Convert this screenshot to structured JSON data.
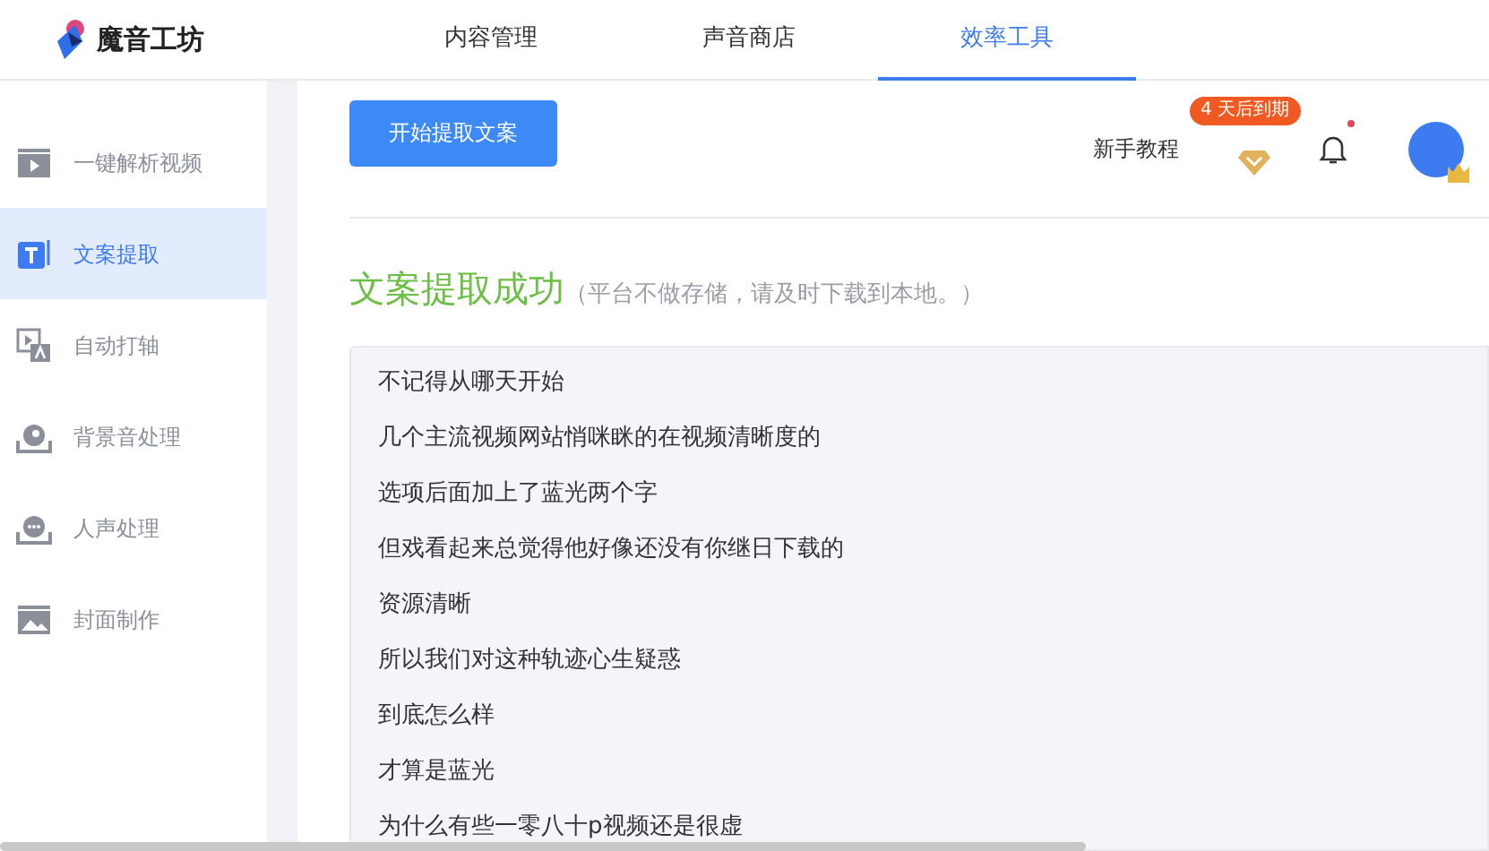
{
  "logo": {
    "text": "魔音工坊"
  },
  "top_tabs": [
    {
      "label": "内容管理",
      "selected": false
    },
    {
      "label": "声音商店",
      "selected": false
    },
    {
      "label": "效率工具",
      "selected": true
    }
  ],
  "sidebar": {
    "items": [
      {
        "label": "一键解析视频",
        "kind": "video",
        "selected": false
      },
      {
        "label": "文案提取",
        "kind": "text",
        "selected": true
      },
      {
        "label": "自动打轴",
        "kind": "subtitle",
        "selected": false
      },
      {
        "label": "背景音处理",
        "kind": "music",
        "selected": false
      },
      {
        "label": "人声处理",
        "kind": "voice",
        "selected": false
      },
      {
        "label": "封面制作",
        "kind": "cover",
        "selected": false
      }
    ]
  },
  "toolbar": {
    "start_button": "开始提取文案",
    "tutorial_link": "新手教程",
    "expiry_badge": "4 天后到期",
    "notification_dot": true
  },
  "result": {
    "title": "文案提取成功",
    "note": "（平台不做存储，请及时下载到本地。）",
    "lines": [
      "不记得从哪天开始",
      "几个主流视频网站悄咪眯的在视频清晰度的",
      "选项后面加上了蓝光两个字",
      "但戏看起来总觉得他好像还没有你继日下载的",
      "资源清晰",
      "所以我们对这种轨迹心生疑惑",
      "到底怎么样",
      "才算是蓝光",
      "为什么有些一零八十p视频还是很虚"
    ]
  }
}
